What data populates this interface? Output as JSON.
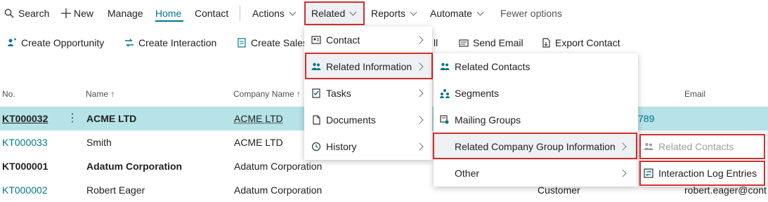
{
  "toolbar": {
    "search": "Search",
    "new": "New",
    "manage": "Manage",
    "home": "Home",
    "contact": "Contact",
    "actions": "Actions",
    "related": "Related",
    "reports": "Reports",
    "automate": "Automate",
    "fewer_options": "Fewer options"
  },
  "actions_row": {
    "create_opportunity": "Create Opportunity",
    "create_interaction": "Create Interaction",
    "create_sales": "Create Sales",
    "trailing_fragment": "ll",
    "send_email": "Send Email",
    "export_contact": "Export Contact"
  },
  "list": {
    "headers": {
      "no": "No.",
      "name": "Name ↑",
      "company": "Company Name ↑",
      "email": "Email"
    },
    "rows": [
      {
        "no": "KT000032",
        "name": "ACME LTD",
        "company": "ACME LTD",
        "tail": "789",
        "selected": true
      },
      {
        "no": "KT000033",
        "name": "Smith",
        "company": "ACME LTD",
        "selected": false
      },
      {
        "no": "KT000001",
        "name": "Adatum Corporation",
        "company": "Adatum Corporation",
        "selected": false
      },
      {
        "no": "KT000002",
        "name": "Robert Eager",
        "company": "Adatum Corporation",
        "type": "Customer",
        "email": "robert.eager@cont",
        "selected": false
      }
    ]
  },
  "related_menu": {
    "items": [
      {
        "label": "Contact",
        "icon": "contact-card-icon"
      },
      {
        "label": "Related Information",
        "icon": "people-icon"
      },
      {
        "label": "Tasks",
        "icon": "task-icon"
      },
      {
        "label": "Documents",
        "icon": "document-icon"
      },
      {
        "label": "History",
        "icon": "history-icon"
      }
    ]
  },
  "related_info_menu": {
    "items": [
      {
        "label": "Related Contacts",
        "icon": "people-icon"
      },
      {
        "label": "Segments",
        "icon": "segments-icon"
      },
      {
        "label": "Mailing Groups",
        "icon": "mailing-groups-icon"
      },
      {
        "label": "Related Company Group Information",
        "icon": ""
      },
      {
        "label": "Other",
        "icon": ""
      }
    ]
  },
  "company_group_menu": {
    "items": [
      {
        "label": "Related Contacts",
        "icon": "people-icon",
        "disabled": true
      },
      {
        "label": "Interaction Log Entries",
        "icon": "log-entries-icon",
        "disabled": false
      }
    ]
  },
  "colors": {
    "accent": "#00758f",
    "highlight": "#d32f2f",
    "selected_row": "#b6e3e8"
  }
}
